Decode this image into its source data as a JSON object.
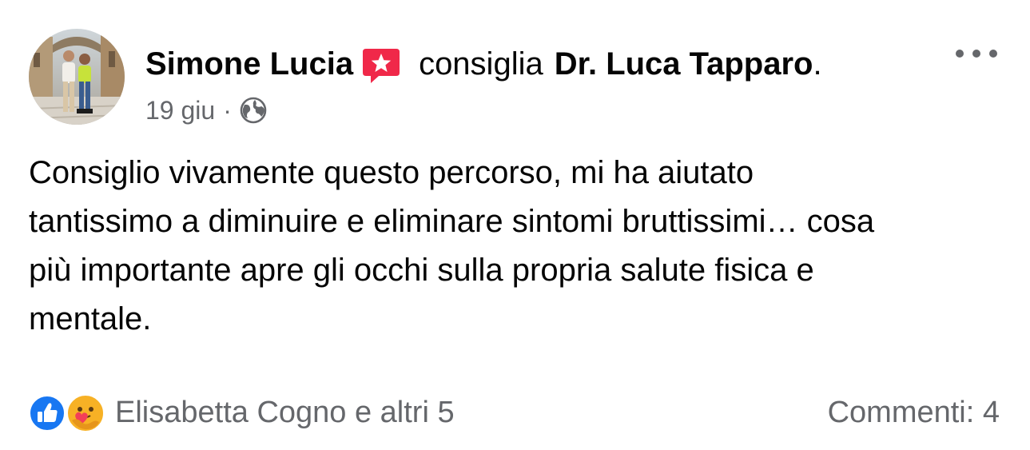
{
  "post": {
    "author_name": "Simone Lucia",
    "verb": "consiglia",
    "page_name": "Dr. Luca Tapparo",
    "page_suffix": ".",
    "timestamp": "19 giu",
    "separator": "·",
    "audience_icon": "globe-icon",
    "badge_icon": "recommendation-star-icon",
    "menu_icon": "more-options-icon",
    "body_lines": [
      "Consiglio vivamente questo percorso, mi ha aiutato",
      "tantissimo a diminuire e eliminare sintomi bruttissimi… cosa",
      "più importante apre gli occhi sulla propria salute fisica e",
      "mentale."
    ]
  },
  "reactions": {
    "icons": [
      "like-icon",
      "care-icon"
    ],
    "summary": "Elisabetta Cogno e altri 5",
    "comments": "Commenti: 4"
  },
  "colors": {
    "text": "#050505",
    "secondary_text": "#65676b",
    "badge": "#f02849",
    "like_blue": "#1877f2",
    "care_yellow": "#f7b125"
  }
}
